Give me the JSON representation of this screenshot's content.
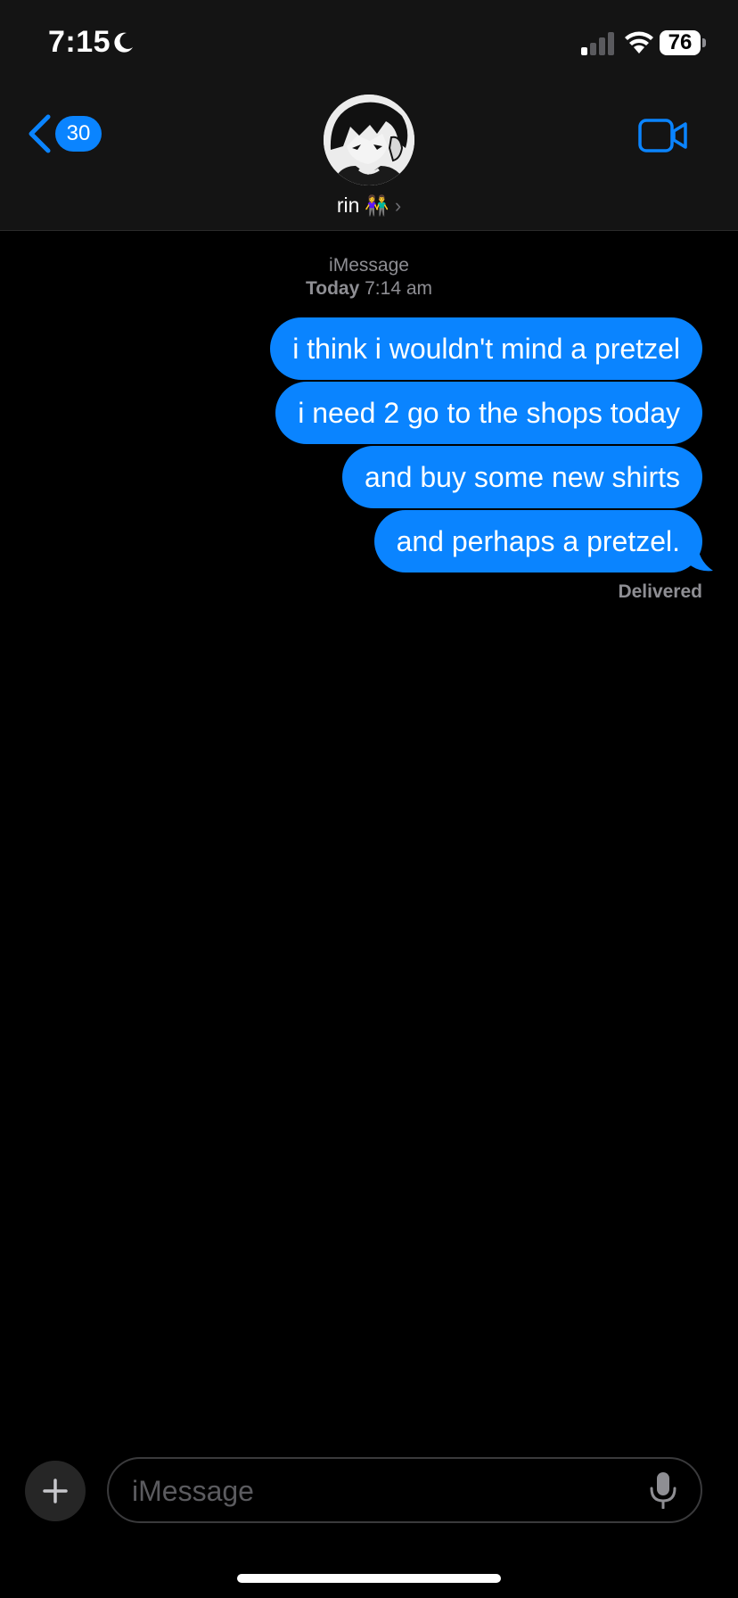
{
  "status_bar": {
    "time": "7:15",
    "battery": "76",
    "icons": [
      "moon-icon",
      "cellular-signal-icon",
      "wifi-icon",
      "battery-icon"
    ]
  },
  "header": {
    "back_badge_count": "30",
    "contact_name": "rin",
    "contact_emoji": "👫",
    "icons": [
      "chevron-left-icon",
      "chevron-right-icon",
      "video-camera-icon"
    ]
  },
  "conversation": {
    "service": "iMessage",
    "timestamp_day": "Today",
    "timestamp_time": "7:14 am",
    "messages": [
      {
        "text": "i think i wouldn't mind a pretzel",
        "sender": "me"
      },
      {
        "text": "i need 2 go to the shops today",
        "sender": "me"
      },
      {
        "text": "and buy some new shirts",
        "sender": "me"
      },
      {
        "text": "and perhaps a pretzel.",
        "sender": "me"
      }
    ],
    "status": "Delivered"
  },
  "input_bar": {
    "placeholder": "iMessage",
    "icons": [
      "plus-icon",
      "microphone-icon"
    ]
  },
  "colors": {
    "accent": "#0a84ff",
    "background": "#000000",
    "header_background": "#141414",
    "secondary_text": "#8e8e93"
  }
}
